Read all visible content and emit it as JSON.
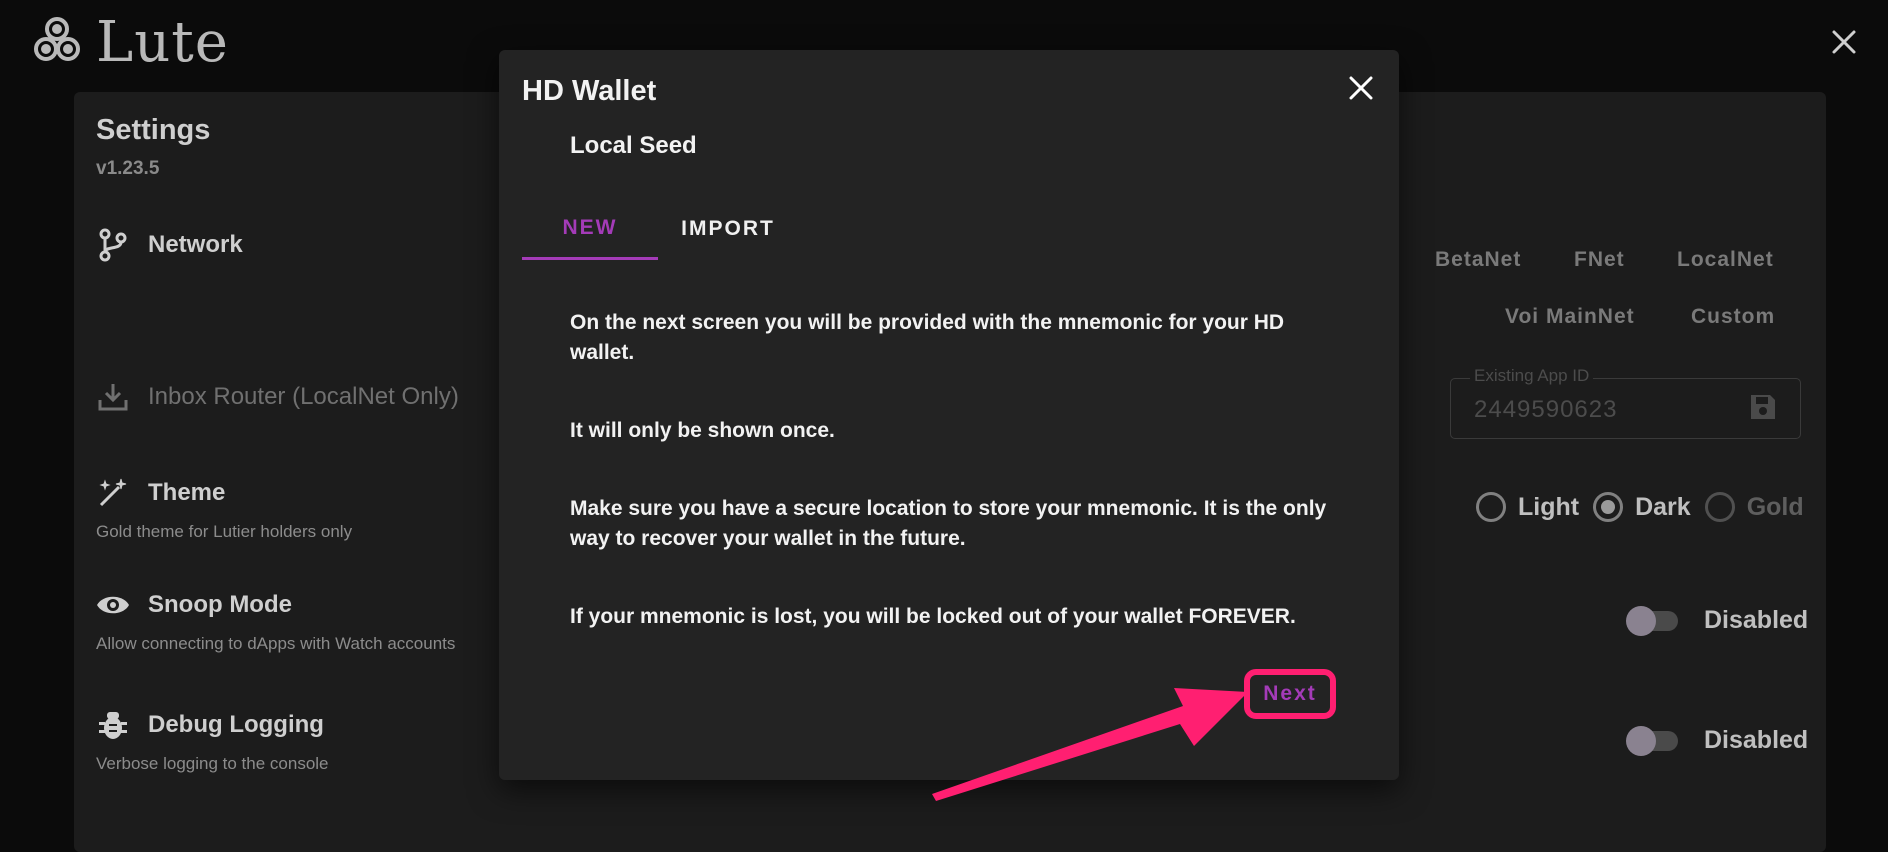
{
  "app": {
    "name": "Lute"
  },
  "settings": {
    "title": "Settings",
    "version": "v1.23.5",
    "network": {
      "label": "Network",
      "chips": [
        "BetaNet",
        "FNet",
        "LocalNet",
        "Voi MainNet",
        "Custom"
      ]
    },
    "inbox_router": {
      "label": "Inbox Router (LocalNet Only)",
      "field_label": "Existing App ID",
      "field_value": "2449590623"
    },
    "theme": {
      "label": "Theme",
      "desc": "Gold theme for Lutier holders only",
      "options": [
        {
          "label": "Light",
          "checked": false
        },
        {
          "label": "Dark",
          "checked": true
        },
        {
          "label": "Gold",
          "checked": false
        }
      ]
    },
    "snoop_mode": {
      "label": "Snoop Mode",
      "desc": "Allow connecting to dApps with Watch accounts",
      "state": "Disabled"
    },
    "debug_logging": {
      "label": "Debug Logging",
      "desc": "Verbose logging to the console",
      "state": "Disabled"
    }
  },
  "modal": {
    "title": "HD Wallet",
    "subtitle": "Local Seed",
    "tabs": [
      {
        "label": "NEW",
        "active": true
      },
      {
        "label": "IMPORT",
        "active": false
      }
    ],
    "paragraphs": [
      "On the next screen you will be provided with the mnemonic for your HD wallet.",
      "It will only be shown once.",
      "Make sure you have a secure location to store your mnemonic. It is the only way to recover your wallet in the future."
    ],
    "warning_prefix": "If your mnemonic is lost, you will be locked out of your wallet ",
    "warning_emphasis": "FOREVER",
    "warning_suffix": ".",
    "next_label": "Next"
  },
  "colors": {
    "accent_purple": "#a43bb8",
    "highlight_pink": "#ff1f71",
    "modal_bg": "#232323",
    "page_bg": "#0b0b0b"
  },
  "icons": {
    "logo": "triskelion-icon",
    "app_close": "close-icon",
    "network": "branch-icon",
    "inbox_router": "download-icon",
    "theme": "magic-wand-icon",
    "snoop_mode": "eye-icon",
    "debug_logging": "bug-icon",
    "save": "save-icon",
    "modal_close": "close-icon"
  }
}
